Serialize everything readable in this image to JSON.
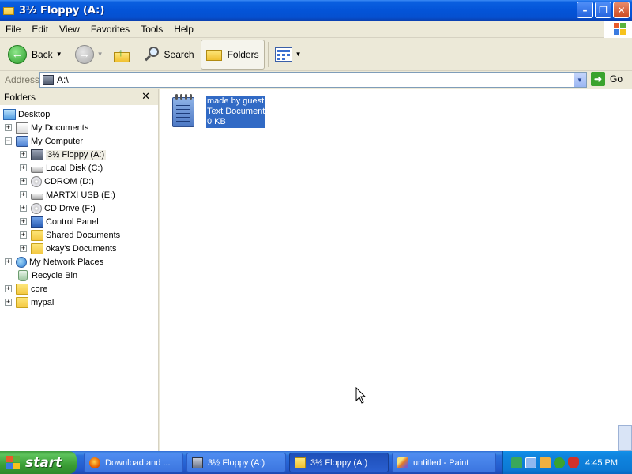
{
  "window": {
    "title": "3½ Floppy (A:)"
  },
  "menu": [
    "File",
    "Edit",
    "View",
    "Favorites",
    "Tools",
    "Help"
  ],
  "toolbar": {
    "back_label": "Back",
    "search_label": "Search",
    "folders_label": "Folders"
  },
  "address": {
    "label": "Address",
    "value": "A:\\",
    "go_label": "Go"
  },
  "folders_pane": {
    "title": "Folders",
    "items": [
      {
        "label": "Desktop"
      },
      {
        "label": "My Documents"
      },
      {
        "label": "My Computer"
      },
      {
        "label": "3½ Floppy (A:)"
      },
      {
        "label": "Local Disk (C:)"
      },
      {
        "label": "CDROM (D:)"
      },
      {
        "label": "MARTXI USB (E:)"
      },
      {
        "label": "CD Drive (F:)"
      },
      {
        "label": "Control Panel"
      },
      {
        "label": "Shared Documents"
      },
      {
        "label": "okay's Documents"
      },
      {
        "label": "My Network Places"
      },
      {
        "label": "Recycle Bin"
      },
      {
        "label": "core"
      },
      {
        "label": "mypal"
      }
    ]
  },
  "file": {
    "name": "made by guest",
    "type": "Text Document",
    "size": "0 KB"
  },
  "taskbar": {
    "start_label": "start",
    "tasks": [
      {
        "label": "Download and ..."
      },
      {
        "label": "3½ Floppy (A:)"
      },
      {
        "label": "3½ Floppy (A:)"
      },
      {
        "label": "untitled - Paint"
      }
    ],
    "clock": "4:45 PM"
  },
  "colors": {
    "titlebar": "#0454d8",
    "selection": "#316ac5",
    "taskbar": "#2359cc",
    "start": "#3a9e35"
  }
}
